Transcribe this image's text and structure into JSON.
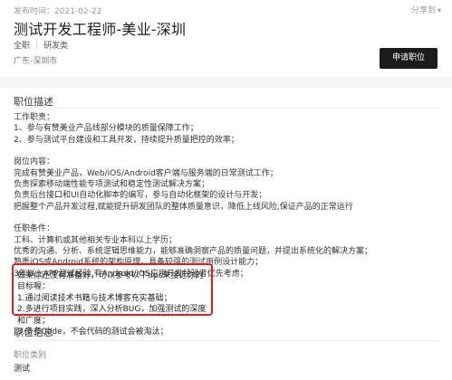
{
  "header": {
    "publish_label": "发布时间：",
    "publish_date": "2021-02-22",
    "share_label": "分享到",
    "job_title": "测试开发工程师-美业-深圳",
    "tags": [
      "全职",
      "研发类"
    ],
    "location": "广东-深圳市",
    "apply_button": "申请职位"
  },
  "description": {
    "section_title": "职位描述",
    "duties_heading": "工作职责：",
    "duties": [
      "1、参与有赞美业产品线部分模块的质量保障工作；",
      "2、参与测试平台建设和工具开发，持续提升质量把控的效率；"
    ],
    "post_heading": "岗位内容：",
    "post_items": [
      "完成有赞美业产品，Web/iOS/Android客户端与服务端的日常测试工作；",
      "负责探索移动端性能专项测试和稳定性测试解决方案；",
      "负责后台接口和UI自动化脚本的编写，参与自动化框架的设计与开发；",
      "把握整个产品开发过程,赋能提升研发团队的整体质量意识，降低上线风险,保证产品的正常运行"
    ],
    "req_heading": "任职条件：",
    "req_items": [
      "工科、计算机或其他相关专业本科以上学历；",
      "优秀的沟通、分析、系统逻辑思维能力，能够准确洞察产品的质量问题，并提出系统化的解决方案；",
      "熟悉iOS或Android系统的架构原理，具备较强的测试用例设计能力；",
      "3年以上APP测试经验,有Android/iOS应用开发经验者优先考虑；"
    ],
    "tips": [
      "如果你还没有准备好，可以参考以下tips来接近你的目标喔：",
      "1.通过阅读技术书籍与技术博客充实基础；",
      "2.多进行项目实践，深入分析BUG，加强测试的深度和广度；",
      "3.多多Code，不会代码的测试会被淘汰；"
    ]
  },
  "info": {
    "section_title": "职位信息",
    "category_label": "职位类别",
    "category_value": "测试"
  },
  "colors": {
    "highlight_border": "#e0201c",
    "apply_bg": "#1b1b1b"
  }
}
